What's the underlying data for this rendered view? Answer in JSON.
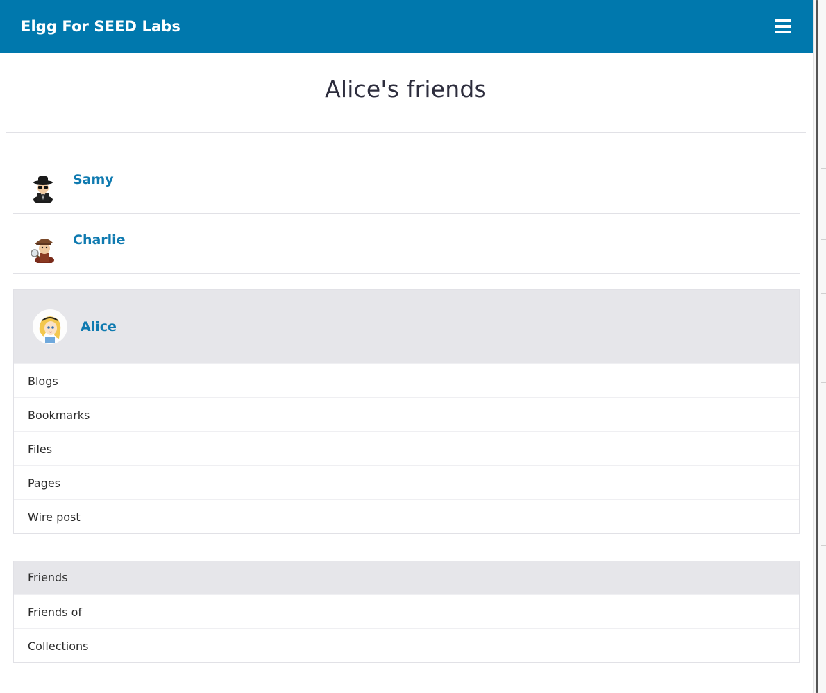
{
  "topbar": {
    "site_name": "Elgg For SEED Labs",
    "menu_icon": "hamburger-menu-icon"
  },
  "page": {
    "title": "Alice's friends"
  },
  "friends": [
    {
      "name": "Samy",
      "avatar": "spy-avatar"
    },
    {
      "name": "Charlie",
      "avatar": "detective-avatar"
    }
  ],
  "owner": {
    "name": "Alice",
    "avatar": "alice-avatar",
    "menu": [
      "Blogs",
      "Bookmarks",
      "Files",
      "Pages",
      "Wire post"
    ]
  },
  "page_menu": {
    "selected": "Friends",
    "items": [
      "Friends",
      "Friends of",
      "Collections"
    ]
  },
  "colors": {
    "topbar": "#0078ad",
    "link": "#0f7ab0",
    "panel": "#e6e6ea"
  }
}
